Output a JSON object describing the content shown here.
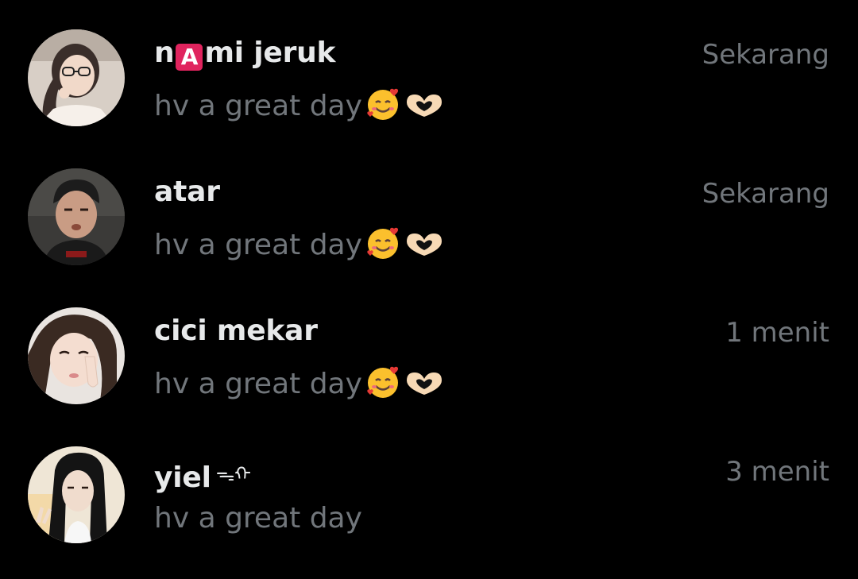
{
  "conversations": [
    {
      "name_prefix": "n",
      "name_badge": "A",
      "name_suffix": "mi jeruk",
      "message": "hv a great day",
      "has_emojis": true,
      "time": "Sekarang",
      "avatar_icon": "avatar-photo-glasses"
    },
    {
      "name": "atar",
      "message": "hv a great day",
      "has_emojis": true,
      "time": "Sekarang",
      "avatar_icon": "avatar-photo-man"
    },
    {
      "name": "cici mekar",
      "message": "hv a great day",
      "has_emojis": true,
      "time": "1 menit",
      "avatar_icon": "avatar-photo-woman"
    },
    {
      "name": "yiel",
      "name_glyph": "ᯓᡣ",
      "message": "hv a great day",
      "has_emojis": false,
      "time": "3 menit",
      "avatar_icon": "avatar-photo-longhair"
    }
  ],
  "emoji_icons": [
    "smiling-face-with-hearts-icon",
    "heart-hands-icon"
  ],
  "colors": {
    "background": "#000000",
    "primary_text": "#e7e9ea",
    "secondary_text": "#71767b",
    "badge_red": "#e0245e"
  }
}
